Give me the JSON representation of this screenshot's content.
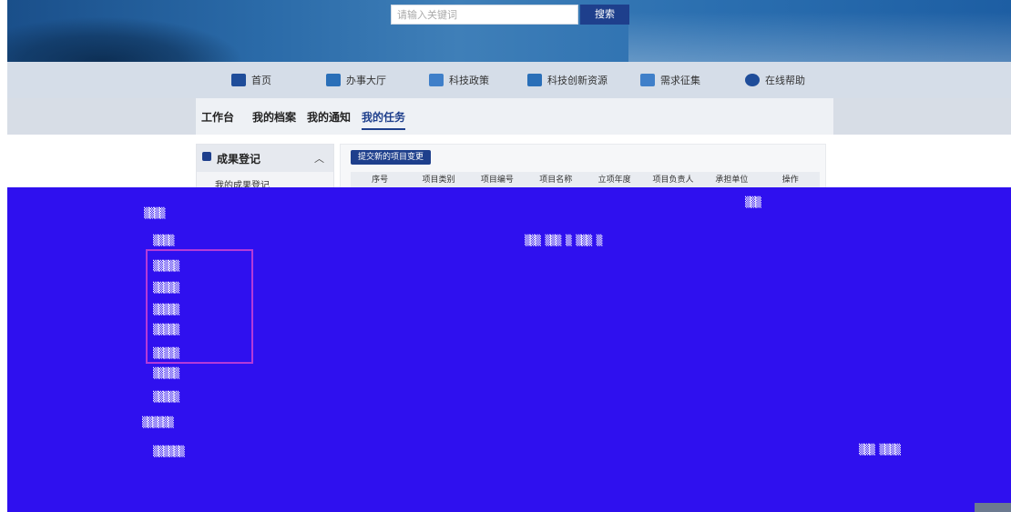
{
  "header": {
    "search_placeholder": "请输入关键词",
    "search_button": "搜索"
  },
  "nav": {
    "items": [
      {
        "label": "首页",
        "icon": "home-icon"
      },
      {
        "label": "办事大厅",
        "icon": "building-icon"
      },
      {
        "label": "科技政策",
        "icon": "folder-icon"
      },
      {
        "label": "科技创新资源",
        "icon": "folder-icon"
      },
      {
        "label": "需求征集",
        "icon": "folder-icon"
      },
      {
        "label": "在线帮助",
        "icon": "help-icon"
      }
    ]
  },
  "subnav": {
    "tabs": [
      "工作台",
      "我的档案",
      "我的通知",
      "我的任务"
    ],
    "active_tab": "我的任务"
  },
  "sidebar": {
    "section_title": "成果登记",
    "first_item": "我的成果登记"
  },
  "main": {
    "submit_button": "提交新的项目变更",
    "table_headers": [
      "序号",
      "项目类别",
      "项目编号",
      "项目名称",
      "立项年度",
      "项目负责人",
      "承担单位",
      "操作"
    ]
  },
  "colors": {
    "accent": "#1e3f8c",
    "overlay": "#2f10ef"
  }
}
